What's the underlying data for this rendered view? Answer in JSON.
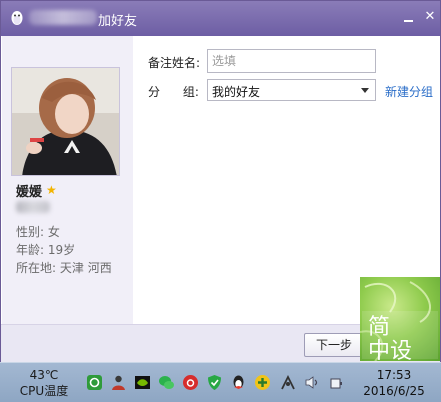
{
  "window": {
    "title": "加好友",
    "minimize_glyph": "",
    "close_glyph": "✕"
  },
  "profile": {
    "nickname": "媛媛",
    "gender_label": "性别:",
    "gender": "女",
    "age_label": "年龄:",
    "age": "19岁",
    "location_label": "所在地:",
    "location": "天津  河西"
  },
  "form": {
    "remark_label": "备注姓名:",
    "remark_placeholder": "选填",
    "remark_value": "",
    "group_label": "分      组:",
    "group_value": "我的好友",
    "new_group_link": "新建分组"
  },
  "footer": {
    "next_label": "下一步"
  },
  "watermark": {
    "line1": "简",
    "line2": "中设"
  },
  "taskbar": {
    "temperature": "43℃",
    "temp_label": "CPU温度",
    "time": "17:53",
    "date": "2016/6/25",
    "tray_icons": [
      "360-guard-icon",
      "user-icon",
      "nvidia-icon",
      "wechat-icon",
      "netease-music-icon",
      "shield-icon",
      "qq-icon",
      "plus-icon",
      "network-icon",
      "volume-icon",
      "power-icon"
    ]
  },
  "colors": {
    "titlebar": "#6d5ea4",
    "link": "#2a6dc8",
    "star": "#f2b400",
    "taskbar": "#8ea6c3"
  }
}
